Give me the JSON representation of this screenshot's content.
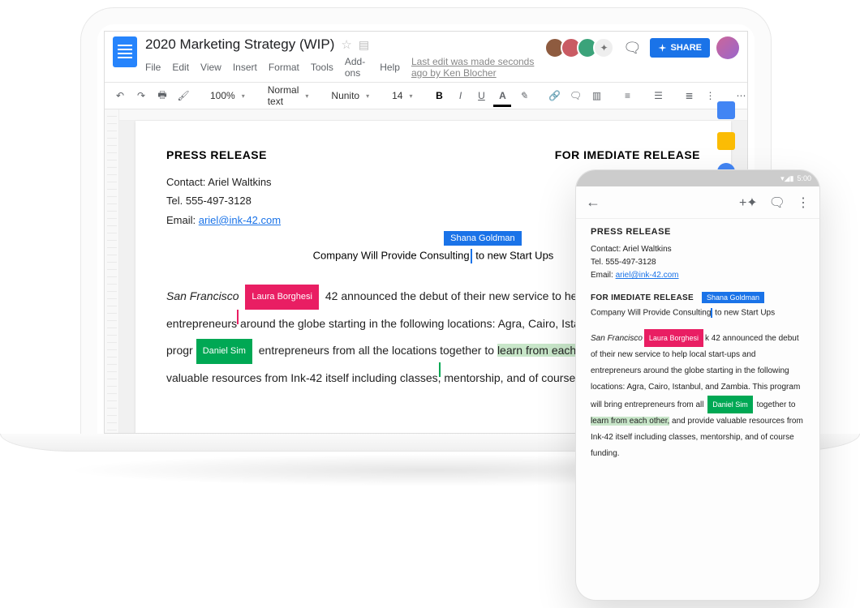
{
  "header": {
    "doc_title": "2020 Marketing Strategy (WIP)",
    "last_edit": "Last edit was made seconds ago by Ken Blocher",
    "share_label": "SHARE"
  },
  "menus": {
    "file": "File",
    "edit": "Edit",
    "view": "View",
    "insert": "Insert",
    "format": "Format",
    "tools": "Tools",
    "addons": "Add-ons",
    "help": "Help"
  },
  "toolbar": {
    "zoom": "100%",
    "style": "Normal text",
    "font": "Nunito",
    "size": "14"
  },
  "collaborators": {
    "shana": "Shana Goldman",
    "laura": "Laura Borghesi",
    "daniel": "Daniel Sim"
  },
  "avatar_colors": [
    "#8e5b3f",
    "#c95b63",
    "#3ba37a",
    "#bdbdbd"
  ],
  "document": {
    "press_release": "PRESS RELEASE",
    "for_release": "FOR IMEDIATE RELEASE",
    "contact_label": "Contact: Ariel Waltkins",
    "tel": "Tel. 555-497-3128",
    "email_label": "Email: ",
    "email": "ariel@ink-42.com",
    "subtitle_a": "Company Will Provide Consulting",
    "subtitle_b": " to new Start Ups",
    "body_sf": "San Francisco",
    "body_1a": " 42 announced the debut of their new service to help local start-ups and entrepreneurs around the globe starting in the following locations: Agra, Cairo, Istanbul, and Zambia. This progr",
    "body_1b": " entrepreneurs from all the locations together to ",
    "body_hl": "learn from each other,",
    "body_1c": " and provide valuable resources from Ink-42 itself including classes, mentorship, and of course funding."
  },
  "phone": {
    "time": "5:00",
    "press_release": "PRESS RELEASE",
    "contact_label": "Contact: Ariel Waltkins",
    "tel": "Tel. 555-497-3128",
    "email_label": "Email: ",
    "email": "ariel@ink-42.com",
    "for_release": "FOR IMEDIATE RELEASE",
    "subtitle_a": "Company Will Provide Consulting",
    "subtitle_b": " to new Start Ups",
    "body_sf": "San Francisco",
    "body_pre": "k 42 announced the debut of their new service to help local start-ups and entrepreneurs around the globe starting in the following locations: Agra, Cairo, Istanbul, and Zambia. This program will bring entrepreneurs from all ",
    "body_mid": " together to ",
    "body_hl": "learn from each other,",
    "body_post": " and provide valuable resources from Ink-42 itself including classes, mentorship, and of course funding."
  }
}
